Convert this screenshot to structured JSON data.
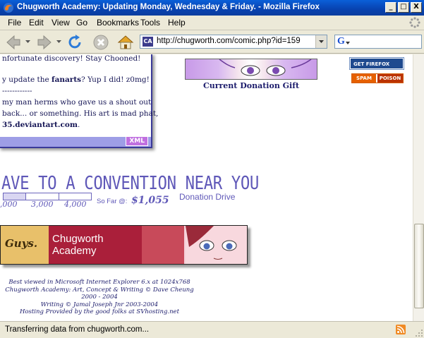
{
  "window": {
    "title": "Chugworth Academy: Updating Monday, Wednesday & Friday. - Mozilla Firefox",
    "minimize_glyph": "_",
    "maximize_glyph": "□",
    "close_glyph": "X"
  },
  "menu": {
    "file": "File",
    "edit": "Edit",
    "view": "View",
    "go": "Go",
    "bookmarks": "Bookmarks",
    "tools": "Tools",
    "help": "Help"
  },
  "nav": {
    "url": "http://chugworth.com/comic.php?id=159",
    "site_icon_text": "CA",
    "search_engine_letter": "G",
    "icons": [
      "back-icon",
      "forward-icon",
      "reload-icon",
      "stop-icon",
      "home-icon"
    ]
  },
  "news": {
    "line1": "nfortunate discovery! Stay Chooned!",
    "line2_pre": "y update the ",
    "line2_bold": "fanarts",
    "line2_post": "? Yup I did! z0mg!",
    "line3": "------------",
    "line4": "my man herms who gave us a shout out",
    "line5": "back... or something. His art is mad phat,",
    "line6_bold": "35.deviantart.com",
    "line6_post": ".",
    "xml_label": "XML"
  },
  "sidebar": {
    "gift_label": "Current Donation Gift",
    "badge_firefox": "GET FIREFOX",
    "badge_spam_a": "SPAM",
    "badge_spam_b": "POISON"
  },
  "donation": {
    "headline": "AVE TO A CONVENTION NEAR YOU",
    "tick_labels": [
      ",000",
      "3,000",
      "4,000"
    ],
    "so_far_label": "So Far @:",
    "so_far_value": "$1,055",
    "drive_label": "Donation Drive",
    "progress_fraction": 0.26
  },
  "banner": {
    "guys_text": "Guys.",
    "title_line1": "Chugworth",
    "title_line2": "Academy"
  },
  "footer": {
    "line1": "Best viewed in Microsoft Internet Explorer 6.x at 1024x768",
    "line2": "Chugworth Academy: Art, Concept & Writing © Dave Cheung 2000 - 2004",
    "line3": "Writing © Jamal Joseph Jnr 2003-2004",
    "line4": "Hosting Provided by the good folks at SVhosting.net"
  },
  "status": {
    "text": "Transferring data from chugworth.com..."
  },
  "colors": {
    "titlebar": "#0842b0",
    "accent_purple": "#5f58b8",
    "news_border": "#3a3a99"
  }
}
